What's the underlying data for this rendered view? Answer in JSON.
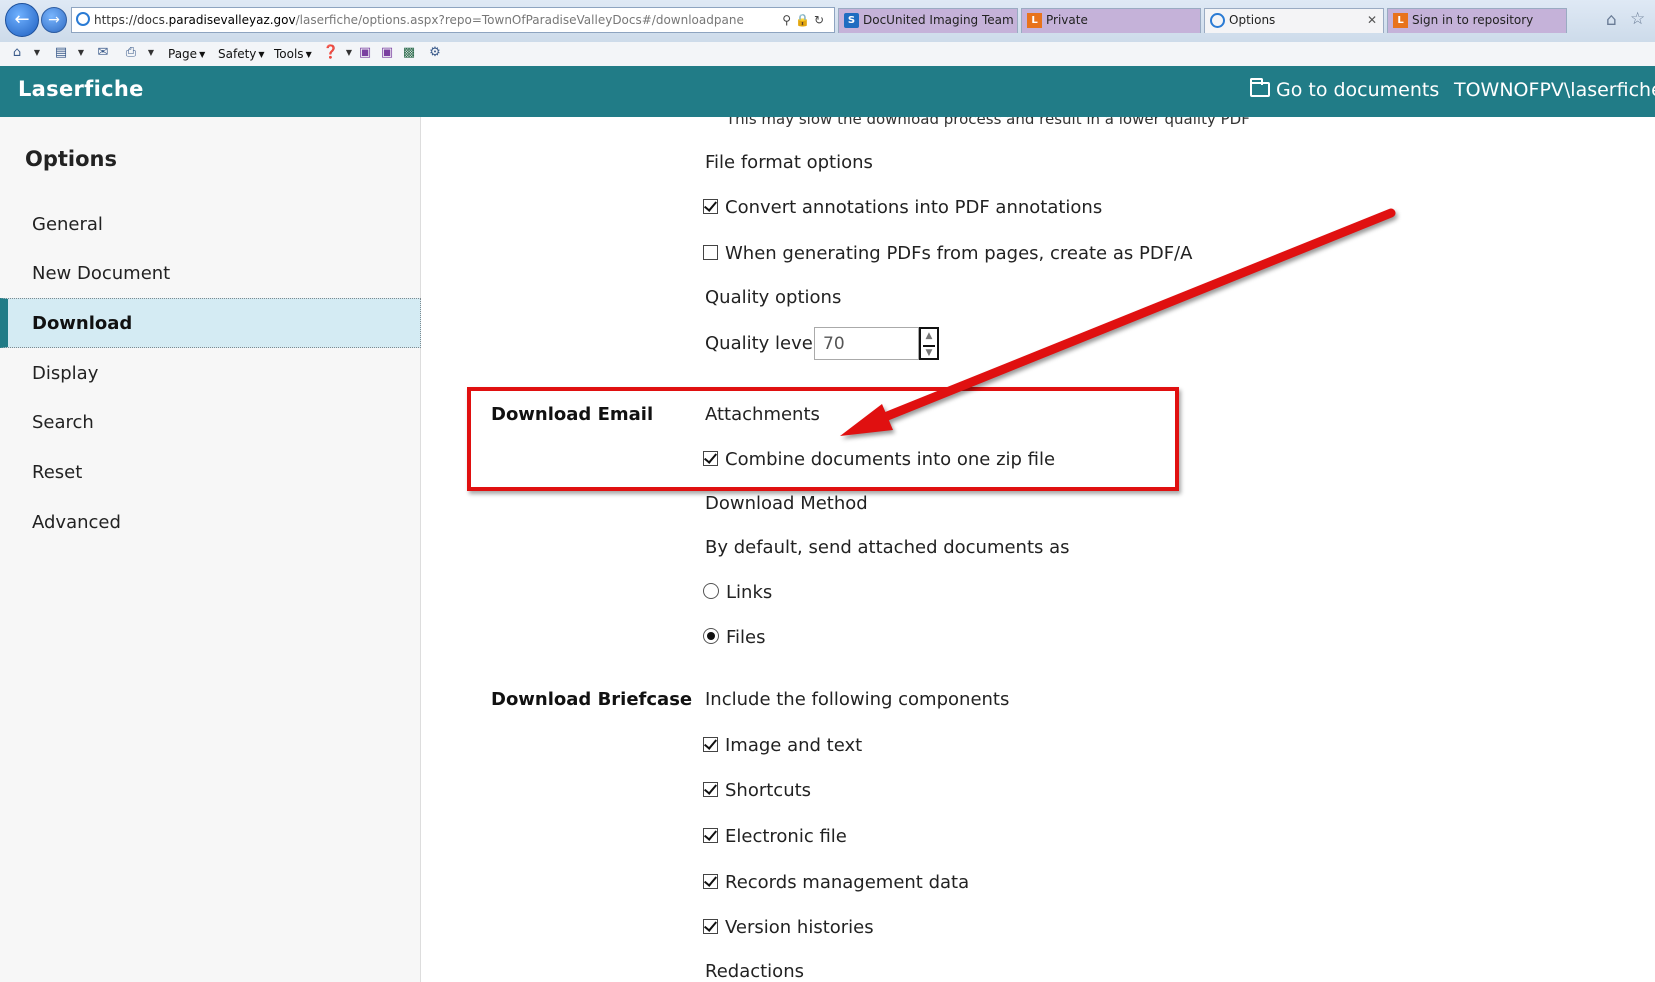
{
  "browser": {
    "address_host_prefix": "https://docs.",
    "address_host": "paradisevalleyaz.gov",
    "address_path": "/laserfiche/options.aspx?repo=TownOfParadiseValleyDocs#/downloadpane",
    "tabs": [
      {
        "label": "DocUnited Imaging Team S...",
        "favicon": "sharepoint-icon"
      },
      {
        "label": "Private",
        "favicon": "laserfiche-icon"
      },
      {
        "label": "Options",
        "favicon": "ie-icon"
      },
      {
        "label": "Sign in to repository",
        "favicon": "laserfiche-icon"
      }
    ],
    "tab_close": "✕",
    "favicon_letter_sp": "S",
    "favicon_letter_l": "L"
  },
  "command_bar": {
    "page": "Page",
    "safety": "Safety",
    "tools": "Tools"
  },
  "header": {
    "brand": "Laserfiche",
    "go_to_documents": "Go to documents",
    "user": "TOWNOFPV\\laserfiche"
  },
  "sidebar": {
    "title": "Options",
    "items": [
      {
        "label": "General"
      },
      {
        "label": "New Document"
      },
      {
        "label": "Download"
      },
      {
        "label": "Display"
      },
      {
        "label": "Search"
      },
      {
        "label": "Reset"
      },
      {
        "label": "Advanced"
      }
    ]
  },
  "main": {
    "top_note": "This may slow the download process and result in a lower quality PDF",
    "file_format_heading": "File format options",
    "convert_annotations": {
      "label": "Convert annotations into PDF annotations",
      "checked": true
    },
    "pdfa": {
      "label": "When generating PDFs from pages, create as PDF/A",
      "checked": false
    },
    "quality_heading": "Quality options",
    "quality_label": "Quality level:",
    "quality_value": "70",
    "download_email": {
      "section_label": "Download Email",
      "attachments_heading": "Attachments",
      "combine_zip": {
        "label": "Combine documents into one zip file",
        "checked": true
      },
      "method_heading": "Download Method",
      "send_as_text": "By default, send attached documents as",
      "options": [
        {
          "label": "Links",
          "checked": false
        },
        {
          "label": "Files",
          "checked": true
        }
      ]
    },
    "download_briefcase": {
      "section_label": "Download Briefcase",
      "components_heading": "Include the following components",
      "components": [
        {
          "label": "Image and text",
          "checked": true
        },
        {
          "label": "Shortcuts",
          "checked": true
        },
        {
          "label": "Electronic file",
          "checked": true
        },
        {
          "label": "Records management data",
          "checked": true
        },
        {
          "label": "Version histories",
          "checked": true
        }
      ],
      "redactions_heading": "Redactions"
    }
  },
  "colors": {
    "header_bg": "#217c87",
    "sidebar_active_bg": "#d4ebf3",
    "annotation_red": "#e01010"
  }
}
